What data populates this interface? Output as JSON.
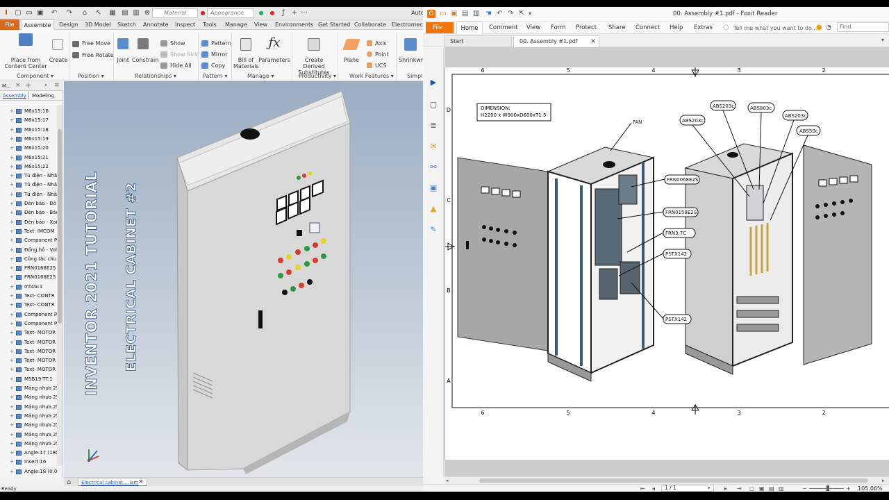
{
  "inventor": {
    "quick_access": {
      "material_placeholder": "Material",
      "appearance_placeholder": "Appearance",
      "product_partial": "Auto"
    },
    "tabs": [
      "File",
      "Assemble",
      "Design",
      "3D Model",
      "Sketch",
      "Annotate",
      "Inspect",
      "Tools",
      "Manage",
      "View",
      "Environments",
      "Get Started",
      "Collaborate",
      "Electromech"
    ],
    "active_tab": "Assemble",
    "ribbon": {
      "place_label": "Place from\nContent Center",
      "create_label": "Create",
      "free_move_label": "Free Move",
      "free_rotate_label": "Free Rotate",
      "joint_label": "Joint",
      "constrain_label": "Constrain",
      "show_label": "Show",
      "show_sick_label": "Show Sick",
      "hide_all_label": "Hide All",
      "pattern_label": "Pattern",
      "mirror_label": "Mirror",
      "copy_label": "Copy",
      "bill_label": "Bill of\nMaterials",
      "parameters_label": "Parameters",
      "create_derived_label": "Create Derived\nSubstitutes",
      "plane_label": "Plane",
      "axis_label": "Axis",
      "point_label": "Point",
      "ucs_label": "UCS",
      "shrinkwrap_label": "Shrinkwra",
      "groups": {
        "component": "Component",
        "position": "Position",
        "relationships": "Relationships",
        "pattern": "Pattern",
        "manage": "Manage",
        "productivity": "Productivity",
        "work_features": "Work Features",
        "simplify": "Simpli"
      }
    },
    "browser": {
      "model_label": "M...",
      "tab_assembly": "Assembly",
      "tab_modeling": "Modeling",
      "items": [
        "M6x15:16",
        "M6x15:17",
        "M6x15:18",
        "M6x15:19",
        "M6x15:20",
        "M6x15:21",
        "M6x15:22",
        "Tủ điện - Nhã",
        "Tủ điện - Nhã",
        "Tủ điện - Nhã",
        "Đèn báo - Đỏ",
        "Đèn báo - Báo",
        "Đèn báo - Xan",
        "Text- IMCOM",
        "Component P",
        "Đồng hồ - Vol",
        "Công tắc chu",
        "FRN0168E25",
        "FRN0168E25",
        "mt4w:1",
        "Text- CONTR",
        "Text- CONTR",
        "Component P",
        "Component P",
        "Text- MOTOR",
        "Text- MOTOR",
        "Text- MOTOR",
        "Text- MOTOR",
        "Text- MOTOR",
        "MSB19-TT:1",
        "Máng nhựa 25",
        "Máng nhựa 25",
        "Máng nhựa 25",
        "Máng nhựa 25",
        "Máng nhựa 25",
        "Máng nhựa 25",
        "Máng nhựa 25",
        "Angle:17 (180",
        "Insert:16",
        "Angle:18 (0.0"
      ]
    },
    "overlay": {
      "line1": "INVENTOR 2021 TUTORIAL",
      "line2": "ELECTRICAL CABINET #2"
    },
    "doc_tab": "Electrical cabinet....iam",
    "status": "Ready"
  },
  "foxit": {
    "window_title": "00. Assembly #1.pdf - Foxit Reader",
    "tabs": [
      "File",
      "Home",
      "Comment",
      "View",
      "Form",
      "Protect",
      "Share",
      "Connect",
      "Help",
      "Extras"
    ],
    "tell_me": "Tell me what you want to do...",
    "find_placeholder": "Find",
    "doc_tabs": [
      "Start",
      "00. Assembly #1.pdf"
    ],
    "page_indicator": "1 / 1",
    "zoom": "105.06%",
    "drawing": {
      "dimension_title": "DIMENSION:",
      "dimension_value": "H2200 x W900xD600xT1.5",
      "fan_label": "FAN",
      "col_labels": [
        "6",
        "5",
        "4",
        "3",
        "2"
      ],
      "row_labels": [
        "D",
        "C",
        "B",
        "A"
      ],
      "callouts_left": [
        "FRN0068E2S",
        "FRN0158E2S",
        "FRN3.7C",
        "PSTX142",
        "PSTX142"
      ],
      "callouts_top": [
        "ABS203c",
        "ABS203c",
        "ABS803c",
        "ABS203c",
        "ABS50c"
      ]
    }
  }
}
